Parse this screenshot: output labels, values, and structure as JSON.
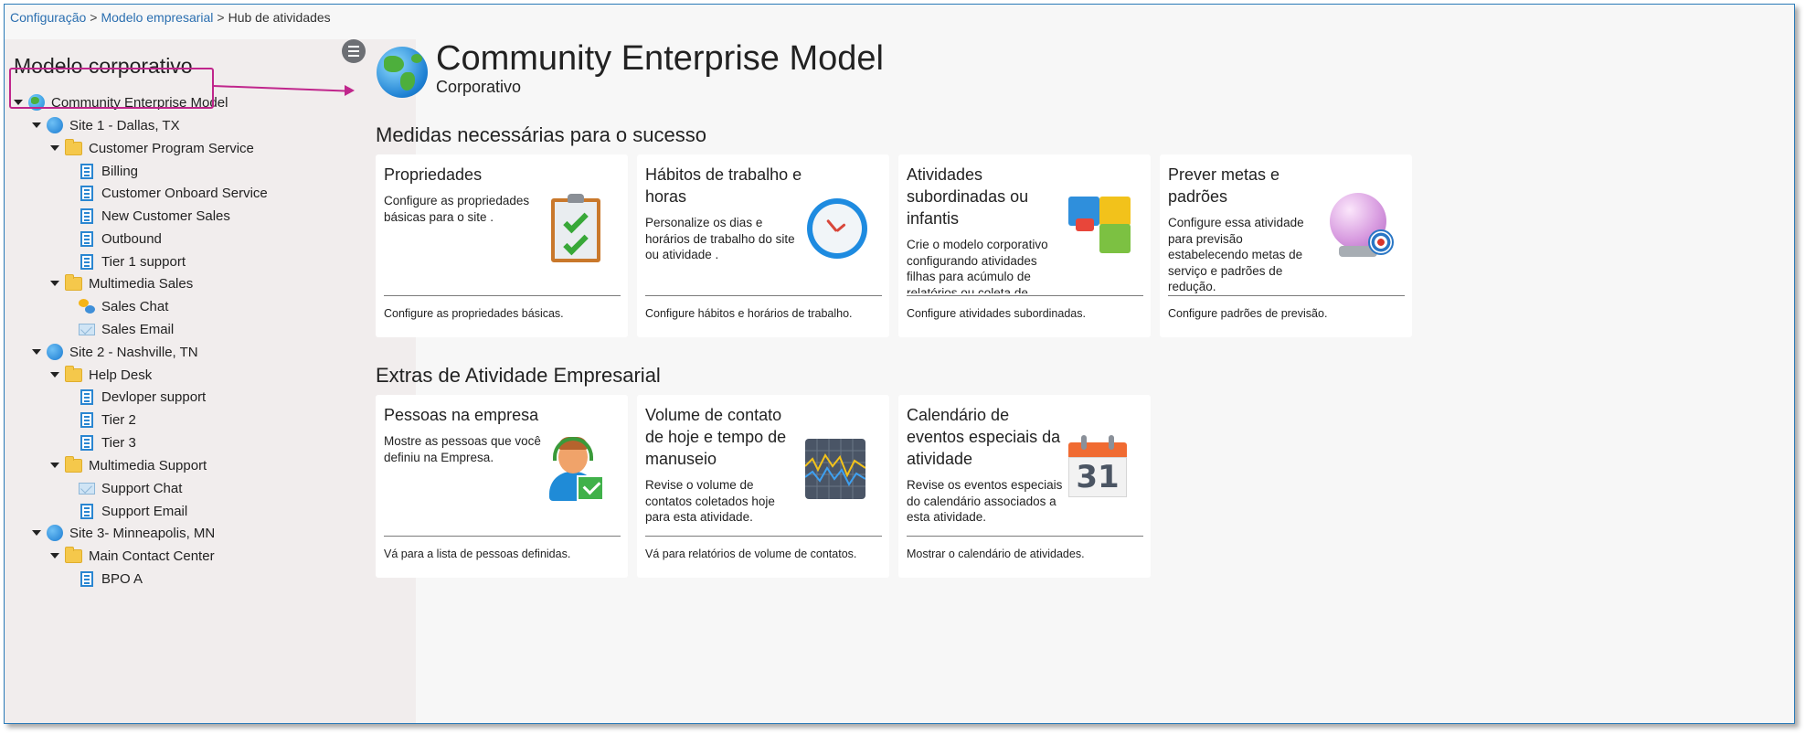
{
  "breadcrumb": {
    "items": [
      "Configuração",
      "Modelo empresarial"
    ],
    "separator": ">",
    "current": "Hub de atividades"
  },
  "sidebar": {
    "title": "Modelo corporativo",
    "tree": [
      {
        "label": "Community Enterprise Model",
        "icon": "earth-icon"
      },
      {
        "label": "Site 1 - Dallas, TX",
        "icon": "globe-icon"
      },
      {
        "label": "Customer Program Service",
        "icon": "folder-icon"
      },
      {
        "label": "Billing",
        "icon": "queue-icon"
      },
      {
        "label": "Customer Onboard Service",
        "icon": "queue-icon"
      },
      {
        "label": "New Customer Sales",
        "icon": "queue-icon"
      },
      {
        "label": "Outbound",
        "icon": "queue-icon"
      },
      {
        "label": "Tier 1 support",
        "icon": "queue-icon"
      },
      {
        "label": "Multimedia Sales",
        "icon": "folder-icon"
      },
      {
        "label": "Sales Chat",
        "icon": "chat-icon"
      },
      {
        "label": "Sales Email",
        "icon": "email-icon"
      },
      {
        "label": "Site 2 - Nashville, TN",
        "icon": "globe-icon"
      },
      {
        "label": "Help Desk",
        "icon": "folder-icon"
      },
      {
        "label": "Devloper support",
        "icon": "queue-icon"
      },
      {
        "label": "Tier 2",
        "icon": "queue-icon"
      },
      {
        "label": "Tier 3",
        "icon": "queue-icon"
      },
      {
        "label": "Multimedia Support",
        "icon": "folder-icon"
      },
      {
        "label": "Support Chat",
        "icon": "email-icon"
      },
      {
        "label": "Support Email",
        "icon": "queue-icon"
      },
      {
        "label": "Site 3- Minneapolis, MN",
        "icon": "globe-icon"
      },
      {
        "label": "Main Contact Center",
        "icon": "folder-icon"
      },
      {
        "label": "BPO A",
        "icon": "queue-icon"
      }
    ]
  },
  "header": {
    "title": "Community Enterprise Model",
    "subtitle": "Corporativo"
  },
  "sections": [
    {
      "heading": "Medidas necessárias para o sucesso",
      "cards": [
        {
          "title": "Propriedades",
          "description": "Configure as propriedades básicas para o site .",
          "link": "Configure as propriedades básicas.",
          "icon": "clipboard-check-icon"
        },
        {
          "title": "Hábitos de trabalho e horas",
          "description": "Personalize os dias e horários de trabalho do site ou atividade .",
          "link": "Configure hábitos e horários de trabalho.",
          "icon": "clock-icon"
        },
        {
          "title": "Atividades subordinadas ou infantis",
          "description": "Crie o modelo corporativo configurando atividades filhas para acúmulo de relatórios ou coleta de",
          "link": "Configure atividades subordinadas.",
          "icon": "puzzle-icon"
        },
        {
          "title": "Prever metas e padrões",
          "description": "Configure essa atividade para previsão estabelecendo metas de serviço e padrões de redução.",
          "link": "Configure padrões de previsão.",
          "icon": "crystal-ball-icon"
        }
      ]
    },
    {
      "heading": "Extras de Atividade Empresarial",
      "cards": [
        {
          "title": "Pessoas na empresa",
          "description": "Mostre as pessoas que você definiu na Empresa.",
          "link": "Vá para a lista de pessoas definidas.",
          "icon": "agent-icon"
        },
        {
          "title": "Volume de contato de hoje e tempo de manuseio",
          "description": "Revise o volume de contatos coletados hoje para esta atividade.",
          "link": "Vá para relatórios de volume de contatos.",
          "icon": "chart-icon"
        },
        {
          "title": "Calendário de eventos especiais da atividade",
          "description": "Revise os eventos especiais do calendário associados a esta atividade.",
          "link": "Mostrar o calendário de atividades.",
          "icon": "calendar-icon",
          "icon_text": "31"
        }
      ]
    }
  ],
  "colors": {
    "annotation": "#c0268c",
    "link": "#2b6fb0",
    "sidebar_bg": "#f1eded",
    "page_bg": "#f7f7f7"
  }
}
